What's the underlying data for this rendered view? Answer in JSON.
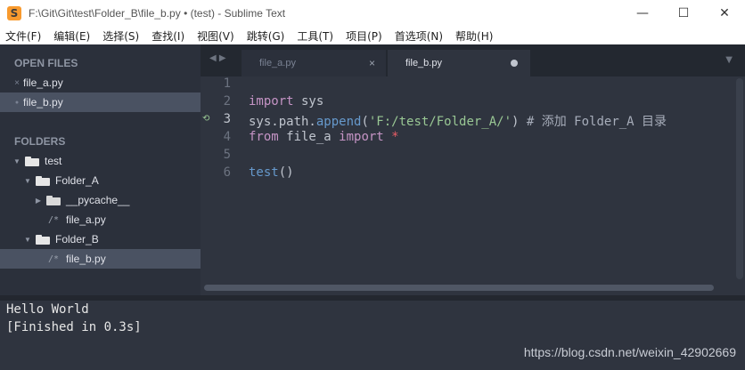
{
  "window": {
    "title": "F:\\Git\\Git\\test\\Folder_B\\file_b.py • (test) - Sublime Text",
    "icon": "sublime-icon",
    "controls": {
      "minimize": "—",
      "maximize": "☐",
      "close": "✕"
    }
  },
  "menu": [
    "文件(F)",
    "编辑(E)",
    "选择(S)",
    "查找(I)",
    "视图(V)",
    "跳转(G)",
    "工具(T)",
    "项目(P)",
    "首选项(N)",
    "帮助(H)"
  ],
  "sidebar": {
    "open_files_header": "OPEN FILES",
    "open_files": [
      {
        "label": "file_a.py",
        "mark": "×"
      },
      {
        "label": "file_b.py",
        "mark": "●"
      }
    ],
    "folders_header": "FOLDERS",
    "tree": [
      {
        "label": "test",
        "arrow": "▼"
      },
      {
        "label": "Folder_A",
        "arrow": "▼"
      },
      {
        "label": "__pycache__",
        "arrow": "▶"
      },
      {
        "label": "file_a.py",
        "icon": "/*"
      },
      {
        "label": "Folder_B",
        "arrow": "▼"
      },
      {
        "label": "file_b.py",
        "icon": "/*"
      }
    ]
  },
  "tabs": {
    "nav_arrows": "◀ ▶",
    "inactive": {
      "label": "file_a.py",
      "close": "×"
    },
    "active": {
      "label": "file_b.py"
    },
    "dropdown": "▼"
  },
  "editor": {
    "line_numbers": [
      "1",
      "2",
      "3",
      "4",
      "5",
      "6"
    ],
    "git_mark": "⟲",
    "lines": {
      "l2_kw": "import",
      "l2_rest": " sys",
      "l3_obj": "sys.path.",
      "l3_fn": "append",
      "l3_open": "(",
      "l3_str": "'F:/test/Folder_A/'",
      "l3_close": ")",
      "l3_comment": " # 添加 Folder_A 目录",
      "l4_kw1": "from",
      "l4_mid": " file_a ",
      "l4_kw2": "import",
      "l4_star": " *",
      "l6_fn": "test",
      "l6_par": "()"
    }
  },
  "console": {
    "lines": [
      "Hello World",
      "[Finished in 0.3s]"
    ],
    "watermark": "https://blog.csdn.net/weixin_42902669"
  },
  "colors": {
    "sidebar_bg": "#2b303b",
    "editor_bg": "#2f343f",
    "keyword": "#c594c5",
    "function": "#6699cc",
    "string": "#99c794",
    "operator": "#ec5f67"
  }
}
